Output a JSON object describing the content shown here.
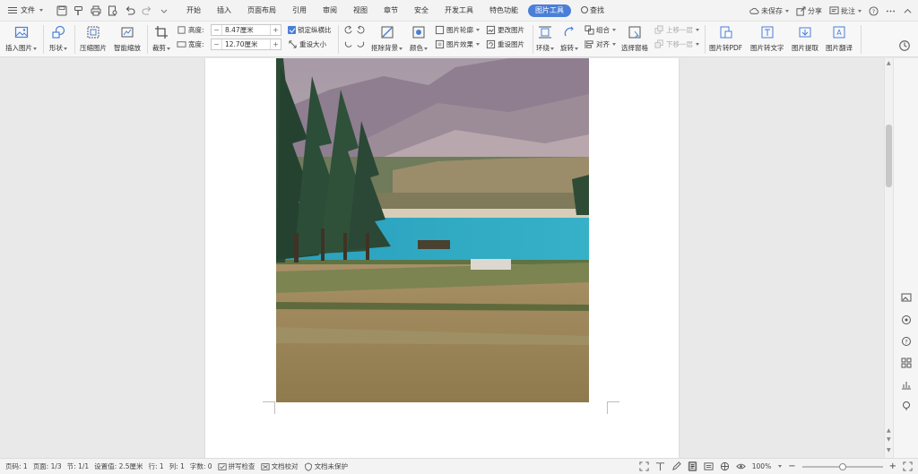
{
  "menubar": {
    "file_label": "文件",
    "tabs": [
      {
        "label": "开始",
        "active": false
      },
      {
        "label": "插入",
        "active": false
      },
      {
        "label": "页面布局",
        "active": false
      },
      {
        "label": "引用",
        "active": false
      },
      {
        "label": "审阅",
        "active": false
      },
      {
        "label": "视图",
        "active": false
      },
      {
        "label": "章节",
        "active": false
      },
      {
        "label": "安全",
        "active": false
      },
      {
        "label": "开发工具",
        "active": false
      },
      {
        "label": "特色功能",
        "active": false
      },
      {
        "label": "图片工具",
        "active": true
      }
    ],
    "search_label": "查找",
    "unsaved_label": "未保存",
    "share_label": "分享",
    "comment_label": "批注",
    "accent_color": "#4a7fd8"
  },
  "ribbon": {
    "insert_image": "插入图片",
    "shape": "形状",
    "compress": "压缩图片",
    "smart_scale": "智能缩放",
    "crop": "裁剪",
    "height_label": "高度:",
    "height_value": "8.47厘米",
    "width_label": "宽度:",
    "width_value": "12.70厘米",
    "lock_ratio": "锁定纵横比",
    "reset_size": "重设大小",
    "remove_bg": "抠除背景",
    "color": "颜色",
    "outline": "图片轮廓",
    "effects": "图片效果",
    "change_image": "更改图片",
    "reset_image": "重设图片",
    "wrap": "环绕",
    "rotate": "旋转",
    "group": "组合",
    "align": "对齐",
    "bring_forward": "上移一层",
    "send_backward": "下移一层",
    "selection_pane": "选择窗格",
    "to_pdf": "图片转PDF",
    "to_text": "图片转文字",
    "extract": "图片提取",
    "translate": "图片翻译"
  },
  "statusbar": {
    "page_code": "页码: 1",
    "pages": "页面: 1/3",
    "section": "节: 1/1",
    "setting": "设置值: 2.5厘米",
    "row": "行: 1",
    "col": "列: 1",
    "word_count": "字数: 0",
    "spell_check": "拼写检查",
    "proofread": "文档校对",
    "unprotected": "文档未保护",
    "zoom": "100%",
    "zoom_level": 0.5
  },
  "icons": [
    "menu-icon",
    "save-icon",
    "print-icon",
    "undo-icon",
    "redo-icon",
    "search-icon",
    "cloud-icon",
    "share-icon",
    "comment-icon",
    "help-icon",
    "more-icon",
    "history-icon"
  ]
}
